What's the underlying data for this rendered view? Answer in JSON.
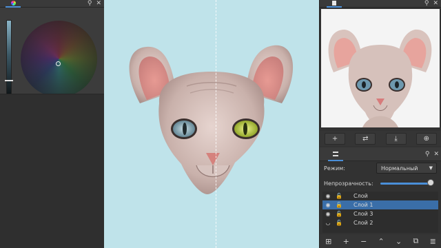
{
  "left_panel": {
    "color_tab_icon": "color-wheel-icon",
    "head_icons": [
      "pin-icon",
      "close-icon"
    ],
    "pin_glyph": "⚲",
    "close_glyph": "✕"
  },
  "right_panel": {
    "overview_tab_icon": "overview-icon",
    "head_icons": [
      "pin-icon",
      "close-icon"
    ],
    "pin_glyph": "⚲",
    "close_glyph": "✕",
    "overview_tools": [
      {
        "name": "zoom-in-button",
        "glyph": "+"
      },
      {
        "name": "flip-button",
        "glyph": "⇄"
      },
      {
        "name": "download-button",
        "glyph": "⤓"
      },
      {
        "name": "add-image-button",
        "glyph": "⊕"
      }
    ],
    "layers": {
      "tab_icon": "layers-icon",
      "mode_label": "Режим:",
      "mode_value": "Нормальный",
      "opacity_label": "Непрозрачность:",
      "opacity_value": 0.97,
      "items": [
        {
          "label": "Слой",
          "selected": false
        },
        {
          "label": "Слой 1",
          "selected": true
        },
        {
          "label": "Слой 3",
          "selected": false
        },
        {
          "label": "Слой 2",
          "selected": false
        }
      ],
      "bottom_tools": [
        {
          "name": "add-layer-button",
          "glyph": "⊞"
        },
        {
          "name": "add-button",
          "glyph": "+"
        },
        {
          "name": "remove-button",
          "glyph": "−"
        },
        {
          "name": "move-up-button",
          "glyph": "⌃"
        },
        {
          "name": "move-down-button",
          "glyph": "⌄"
        },
        {
          "name": "duplicate-button",
          "glyph": "⧉"
        },
        {
          "name": "properties-button",
          "glyph": "≣"
        }
      ]
    }
  },
  "colors": {
    "accent": "#4a8fd8",
    "canvas_bg": "#bfe3ea",
    "panel_bg": "#323232",
    "selected_row": "#3a6ea8"
  }
}
